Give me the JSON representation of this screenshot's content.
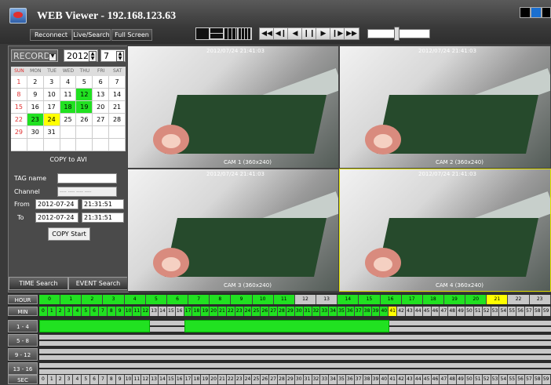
{
  "app": {
    "title": "WEB Viewer - 192.168.123.63",
    "buttons": [
      "Reconnect",
      "Live/Search",
      "Full Screen"
    ]
  },
  "toolbar": {
    "layouts": [
      "layout-1x1",
      "layout-2x2",
      "layout-3x3",
      "layout-4x4"
    ],
    "playback": [
      "◀◀",
      "◀❙",
      "◀",
      "❙❙",
      "▶",
      "❙▶",
      "▶▶"
    ],
    "playback_names": [
      "rewind",
      "step-back",
      "play-reverse",
      "pause",
      "play",
      "step-forward",
      "fast-forward"
    ],
    "speed_level": 0.45
  },
  "search": {
    "mode": "RECORD",
    "year": "2012",
    "month": "7",
    "weekdays": [
      "SUN",
      "MON",
      "TUE",
      "WED",
      "THU",
      "FRI",
      "SAT"
    ],
    "weeks": [
      [
        "1",
        "2",
        "3",
        "4",
        "5",
        "6",
        "7"
      ],
      [
        "8",
        "9",
        "10",
        "11",
        "12",
        "13",
        "14"
      ],
      [
        "15",
        "16",
        "17",
        "18",
        "19",
        "20",
        "21"
      ],
      [
        "22",
        "23",
        "24",
        "25",
        "26",
        "27",
        "28"
      ],
      [
        "29",
        "30",
        "31",
        "",
        "",
        "",
        ""
      ],
      [
        "",
        "",
        "",
        "",
        "",
        "",
        ""
      ]
    ],
    "recorded_days": [
      "12",
      "18",
      "19",
      "23"
    ],
    "selected_day": "24",
    "copy_title": "COPY to AVI",
    "tag_label": "TAG name",
    "tag_value": "",
    "channel_label": "Channel",
    "channel_value": "---- ---- ---- ----",
    "from_label": "From",
    "to_label": "To",
    "from_date": "2012-07-24",
    "from_time": "21:31:51",
    "to_date": "2012-07-24",
    "to_time": "21:31:51",
    "copy_start": "COPY Start",
    "time_search": "TIME Search",
    "event_search": "EVENT Search"
  },
  "cameras": [
    {
      "label": "CAM 1 (360x240)",
      "timestamp": "2012/07/24 21:41:03"
    },
    {
      "label": "CAM 2 (360x240)",
      "timestamp": "2012/07/24 21:41:03"
    },
    {
      "label": "CAM 3 (360x240)",
      "timestamp": "2012/07/24 21:41:03"
    },
    {
      "label": "CAM 4 (360x240)",
      "timestamp": "2012/07/24 21:41:03"
    }
  ],
  "timeline": {
    "labels": {
      "hour": "HOUR",
      "min": "MIN",
      "ch1": "1 - 4",
      "ch2": "5 - 8",
      "ch3": "9 - 12",
      "ch4": "13 - 16",
      "sec": "SEC"
    },
    "hours_visible": [
      "0",
      "1",
      "2",
      "3",
      "4",
      "5",
      "6",
      "7",
      "8",
      "9",
      "10",
      "11",
      "12",
      "13",
      "14",
      "15",
      "16",
      "17",
      "18",
      "19",
      "20",
      "21",
      "22",
      "23"
    ],
    "recorded_hours": [
      0,
      1,
      2,
      3,
      4,
      5,
      6,
      7,
      8,
      9,
      10,
      11,
      14,
      15,
      16,
      17,
      18,
      19,
      20
    ],
    "selected_hour": 21,
    "minutes_visible": 60,
    "recorded_minute_ranges": [
      [
        0,
        12
      ],
      [
        17,
        40
      ]
    ],
    "selected_minute": 41,
    "seconds_visible": 60,
    "colors": {
      "recorded": "#21e121",
      "selected": "#ffff00",
      "empty": "#c8c8c8"
    }
  }
}
